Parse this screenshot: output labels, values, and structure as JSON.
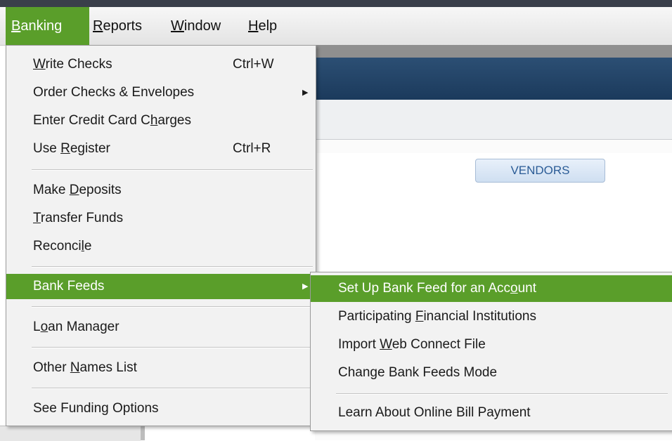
{
  "menubar": {
    "items": [
      {
        "pre": "",
        "ul": "B",
        "post": "anking"
      },
      {
        "pre": "",
        "ul": "R",
        "post": "eports"
      },
      {
        "pre": "",
        "ul": "W",
        "post": "indow"
      },
      {
        "pre": "",
        "ul": "H",
        "post": "elp"
      }
    ]
  },
  "background": {
    "vendors_button": "VENDORS"
  },
  "banking_menu": {
    "items": [
      {
        "pre": "",
        "ul": "W",
        "post": "rite Checks",
        "shortcut": "Ctrl+W"
      },
      {
        "pre": "Order Checks & Envelopes",
        "ul": "",
        "post": "",
        "arrow": "▶"
      },
      {
        "pre": "Enter Credit Card C",
        "ul": "h",
        "post": "arges"
      },
      {
        "pre": "Use ",
        "ul": "R",
        "post": "egister",
        "shortcut": "Ctrl+R"
      },
      {
        "pre": "Make ",
        "ul": "D",
        "post": "eposits"
      },
      {
        "pre": "",
        "ul": "T",
        "post": "ransfer Funds"
      },
      {
        "pre": "Reconci",
        "ul": "l",
        "post": "e"
      },
      {
        "pre": "Bank Feeds",
        "ul": "",
        "post": "",
        "arrow": "▶"
      },
      {
        "pre": "L",
        "ul": "o",
        "post": "an Manager"
      },
      {
        "pre": "Other ",
        "ul": "N",
        "post": "ames List"
      },
      {
        "pre": "See Funding Options",
        "ul": "",
        "post": ""
      }
    ]
  },
  "bank_feeds_submenu": {
    "items": [
      {
        "pre": "Set Up Bank Feed for an Acc",
        "ul": "o",
        "post": "unt"
      },
      {
        "pre": "Participating ",
        "ul": "F",
        "post": "inancial Institutions"
      },
      {
        "pre": "Import ",
        "ul": "W",
        "post": "eb Connect File"
      },
      {
        "pre": "Change Bank Feeds Mode",
        "ul": "",
        "post": ""
      },
      {
        "pre": "Learn About Online Bill Payment",
        "ul": "",
        "post": ""
      }
    ]
  },
  "colors": {
    "highlight": "#5a9e2a",
    "navy_band": "#1b3a5c",
    "menu_bg": "#f2f2f2"
  }
}
